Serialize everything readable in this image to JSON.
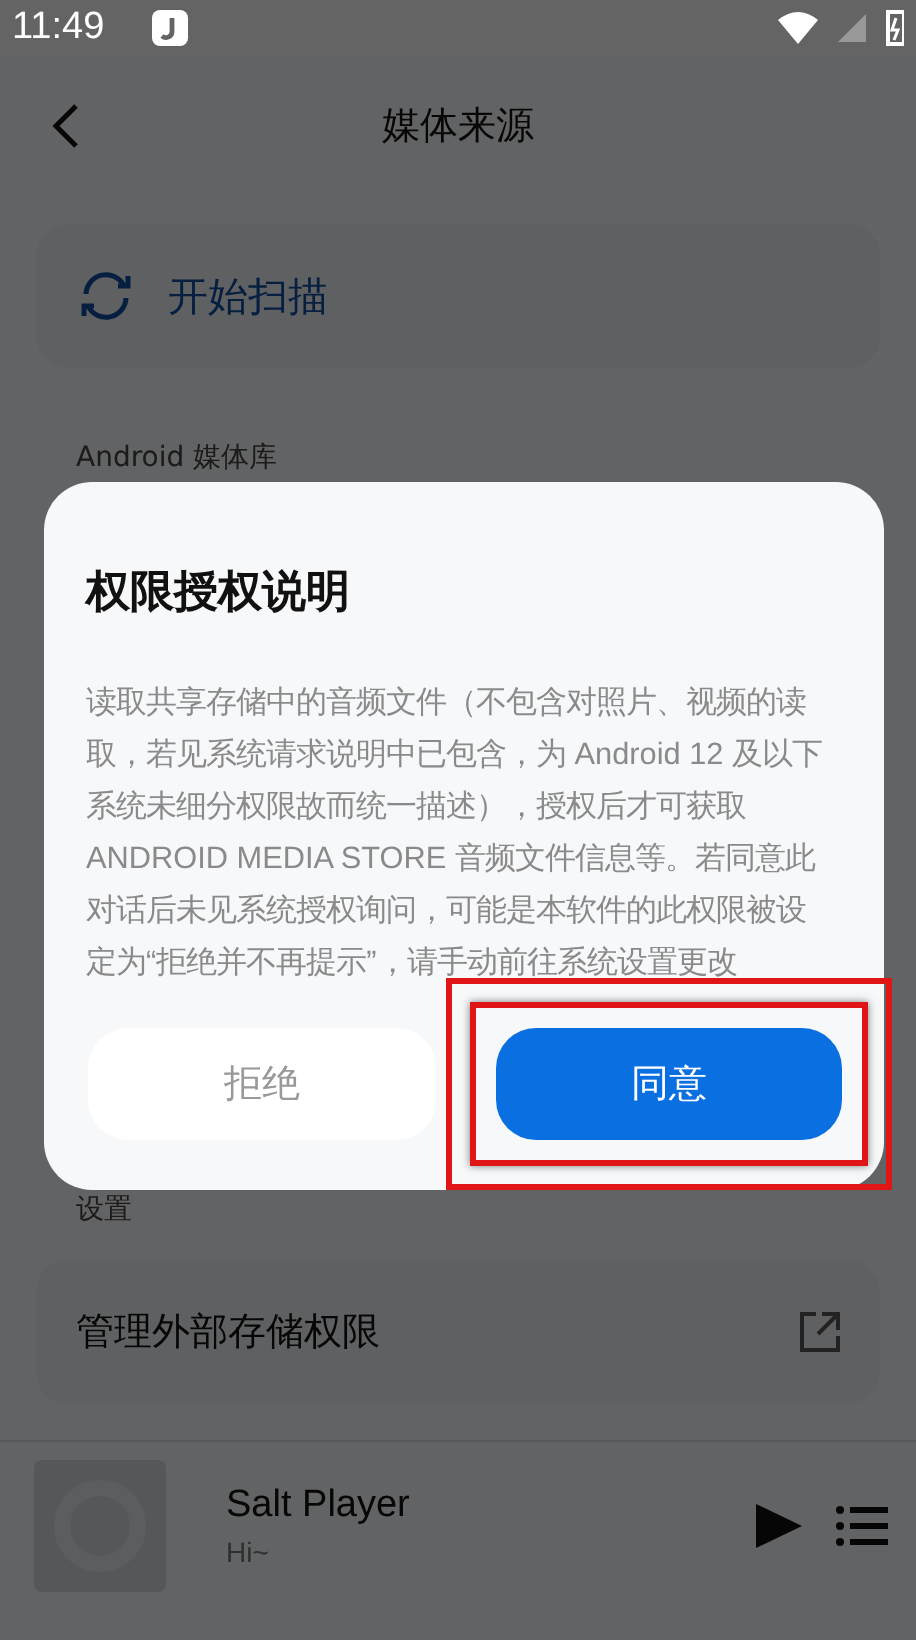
{
  "status_bar": {
    "time": "11:49"
  },
  "header": {
    "title": "媒体来源"
  },
  "scan_card": {
    "label": "开始扫描"
  },
  "sections": [
    {
      "label": "Android 媒体库"
    },
    {
      "label": "设置"
    }
  ],
  "settings_item": {
    "label": "管理外部存储权限"
  },
  "player": {
    "title": "Salt Player",
    "subtitle": "Hi~"
  },
  "dialog": {
    "title": "权限授权说明",
    "body": "读取共享存储中的音频文件（不包含对照片、视频的读取，若见系统请求说明中已包含，为 Android 12 及以下系统未细分权限故而统一描述），授权后才可获取 ANDROID MEDIA STORE 音频文件信息等。若同意此对话后未见系统授权询问，可能是本软件的此权限被设定为“拒绝并不再提示”，请手动前往系统设置更改",
    "buttons": [
      {
        "label": "拒绝",
        "kind": "secondary",
        "highlighted": false
      },
      {
        "label": "同意",
        "kind": "primary",
        "highlighted": true
      }
    ]
  }
}
